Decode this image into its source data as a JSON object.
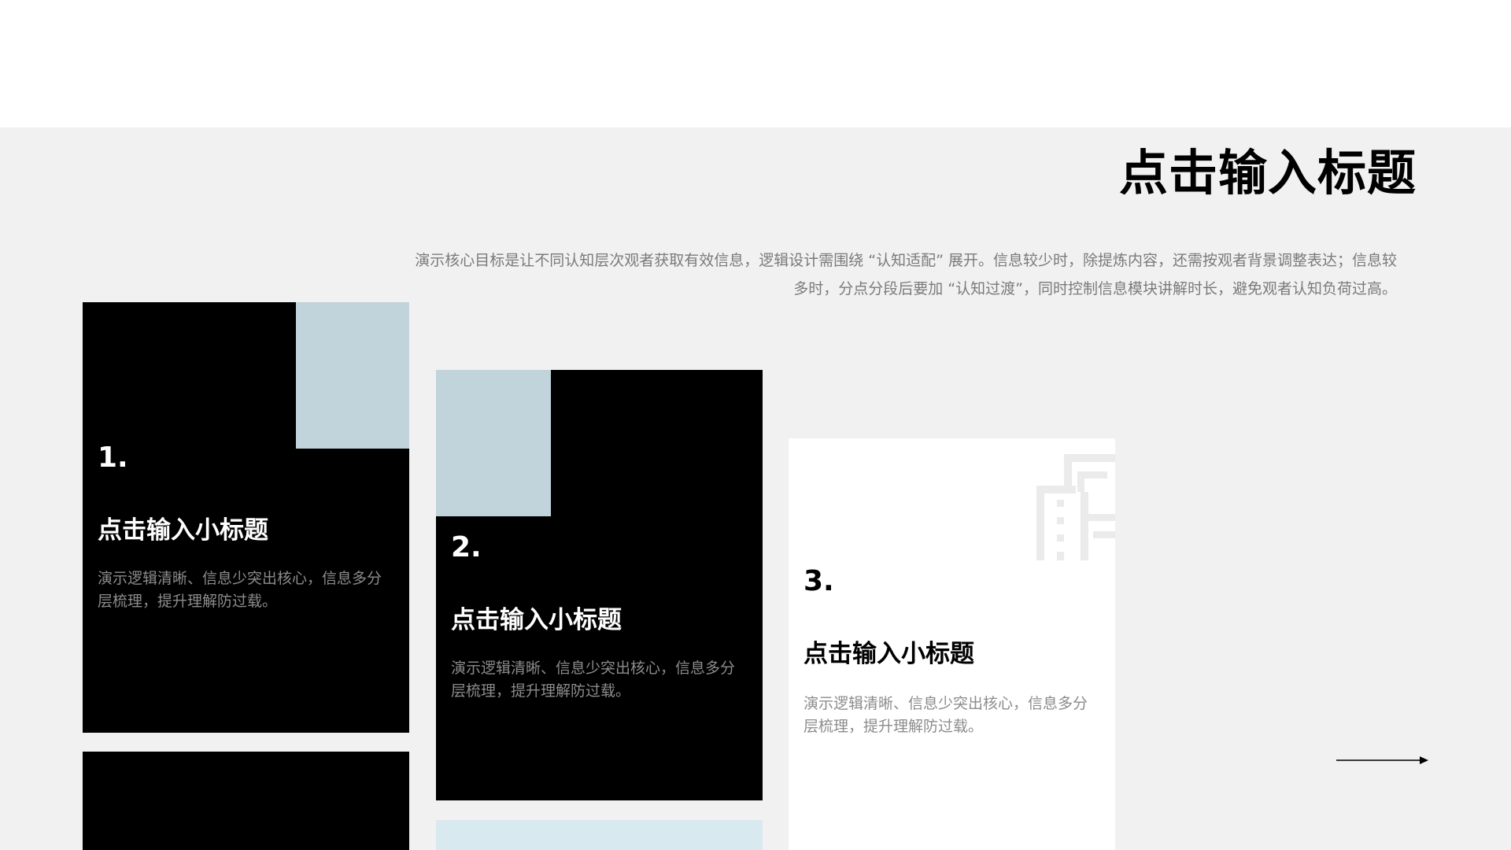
{
  "slide": {
    "title": "点击输入标题",
    "description": "演示核心目标是让不同认知层次观者获取有效信息，逻辑设计需围绕 “认知适配” 展开。信息较少时，除提炼内容，还需按观者背景调整表达；信息较多时，分点分段后要加 “认知过渡”，同时控制信息模块讲解时长，避免观者认知负荷过高。"
  },
  "cards": [
    {
      "number": "1.",
      "subtitle": "点击输入小标题",
      "text": "演示逻辑清晰、信息少突出核心，信息多分层梳理，提升理解防过载。"
    },
    {
      "number": "2.",
      "subtitle": "点击输入小标题",
      "text": "演示逻辑清晰、信息少突出核心，信息多分层梳理，提升理解防过载。"
    },
    {
      "number": "3.",
      "subtitle": "点击输入小标题",
      "text": "演示逻辑清晰、信息少突出核心，信息多分层梳理，提升理解防过载。",
      "icon": "building-icon"
    }
  ],
  "colors": {
    "background": "#f1f1f1",
    "card_dark": "#000000",
    "card_light": "#ffffff",
    "accent_block": "#c1d4db",
    "accent_block_light": "#d8e9ef",
    "body_text": "#8c8c8c"
  },
  "icons": {
    "arrow": "arrow-right-icon"
  }
}
